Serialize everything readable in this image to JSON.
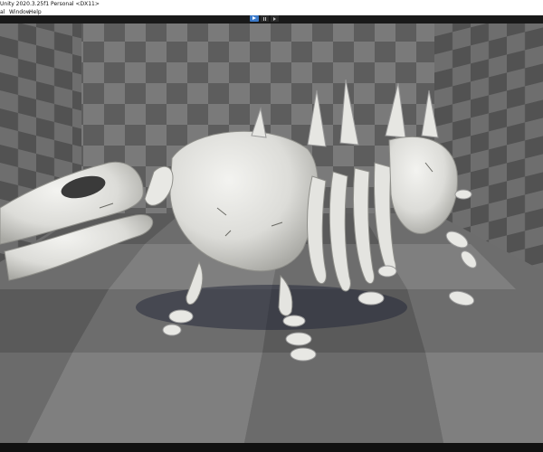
{
  "window": {
    "title": "Unity 2020.3.25f1 Personal <DX11>"
  },
  "menu": {
    "items": [
      "al",
      "Window",
      "Help"
    ]
  },
  "toolbar": {
    "play_icon": "play-icon",
    "pause_icon": "pause-icon",
    "step_icon": "step-icon"
  },
  "viewport": {
    "scene": "checkerboard-room-with-skeleton-dinosaur"
  }
}
